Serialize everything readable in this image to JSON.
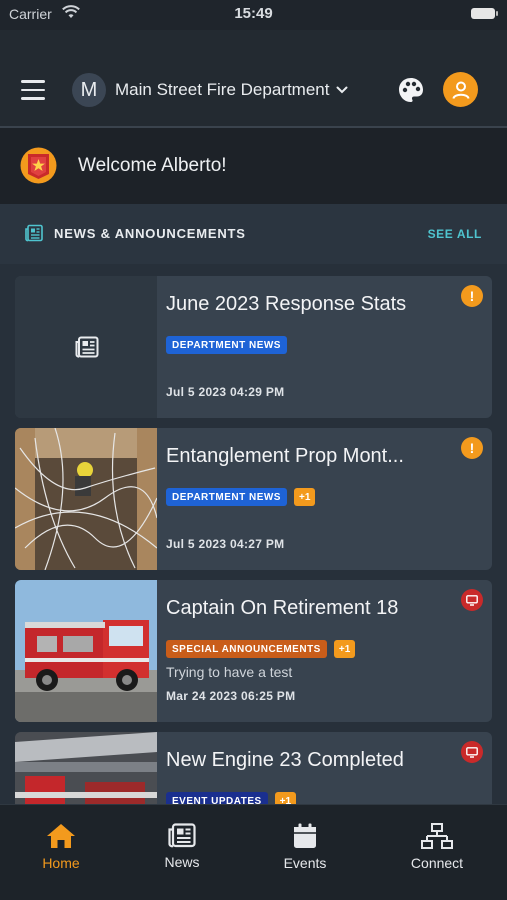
{
  "status_bar": {
    "carrier": "Carrier",
    "time": "15:49"
  },
  "header": {
    "dept_initial": "M",
    "dept_name": "Main Street Fire Department",
    "icons": [
      "menu-icon",
      "chevron-down-icon",
      "palette-icon",
      "user-icon"
    ]
  },
  "welcome": {
    "text": "Welcome Alberto!"
  },
  "news": {
    "title": "NEWS & ANNOUNCEMENTS",
    "see_all": "SEE ALL",
    "items": [
      {
        "title": "June 2023 Response Stats",
        "tag": "DEPARTMENT NEWS",
        "tag_color": "#1e63d6",
        "extra": "",
        "subtitle": "",
        "date": "Jul 5 2023 04:29 PM",
        "alert": "warning",
        "thumb": "placeholder"
      },
      {
        "title": "Entanglement Prop Mont...",
        "tag": "DEPARTMENT NEWS",
        "tag_color": "#1e63d6",
        "extra": "+1",
        "subtitle": "",
        "date": "Jul 5 2023 04:27 PM",
        "alert": "warning",
        "thumb": "entanglement-photo"
      },
      {
        "title": "Captain On Retirement 18",
        "tag": "SPECIAL ANNOUNCEMENTS",
        "tag_color": "#c95d1a",
        "extra": "+1",
        "subtitle": "Trying to have a test",
        "date": "Mar 24 2023 06:25 PM",
        "alert": "screen",
        "thumb": "fire-truck-photo"
      },
      {
        "title": "New Engine 23 Completed",
        "tag": "EVENT UPDATES",
        "tag_color": "#1a2f8f",
        "extra": "+1",
        "subtitle": "",
        "date": "",
        "alert": "screen",
        "thumb": "garage-photo"
      }
    ]
  },
  "tabs": [
    {
      "label": "Home",
      "icon": "home-icon",
      "active": true
    },
    {
      "label": "News",
      "icon": "newspaper-icon",
      "active": false
    },
    {
      "label": "Events",
      "icon": "calendar-icon",
      "active": false
    },
    {
      "label": "Connect",
      "icon": "network-icon",
      "active": false
    }
  ],
  "colors": {
    "accent": "#f39a1d",
    "link": "#4fc4cf",
    "background": "#1f252c",
    "card": "#38434f"
  }
}
